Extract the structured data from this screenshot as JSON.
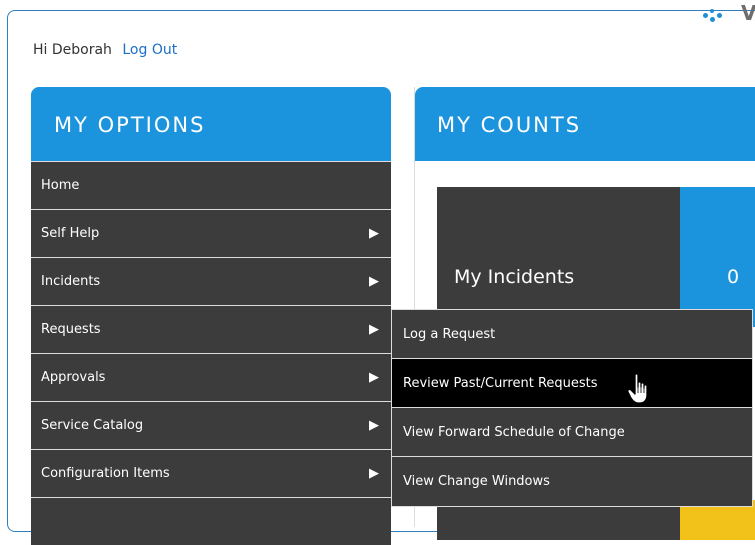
{
  "header": {
    "greeting": "Hi Deborah",
    "logout_label": "Log Out",
    "logo_letter": "V"
  },
  "options": {
    "title": "MY OPTIONS",
    "items": [
      {
        "label": "Home",
        "has_submenu": false
      },
      {
        "label": "Self Help",
        "has_submenu": true
      },
      {
        "label": "Incidents",
        "has_submenu": true
      },
      {
        "label": "Requests",
        "has_submenu": true
      },
      {
        "label": "Approvals",
        "has_submenu": true
      },
      {
        "label": "Service Catalog",
        "has_submenu": true
      },
      {
        "label": "Configuration Items",
        "has_submenu": true
      }
    ],
    "arrow_glyph": "▶"
  },
  "counts": {
    "title": "MY COUNTS",
    "rows": [
      {
        "label": "My Incidents",
        "value": "0"
      }
    ]
  },
  "requests_submenu": {
    "items": [
      {
        "label": "Log a Request"
      },
      {
        "label": "Review Past/Current Requests",
        "hovered": true
      },
      {
        "label": "View Forward Schedule of Change"
      },
      {
        "label": "View Change Windows"
      }
    ]
  },
  "colors": {
    "accent_blue": "#1c94dd",
    "menu_dark": "#3c3c3c",
    "hover_black": "#000000",
    "link_blue": "#1a6fc9",
    "count_yellow": "#f2c21b"
  },
  "icons": {
    "cursor": "hand-pointer-icon",
    "submenu_arrow": "triangle-right-icon"
  }
}
